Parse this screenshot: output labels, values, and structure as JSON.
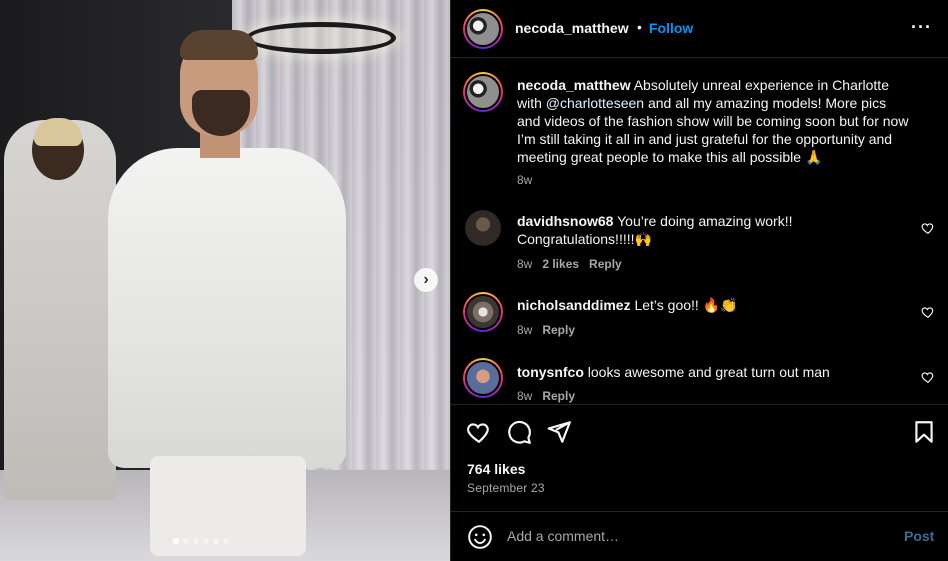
{
  "post": {
    "image_alt": "",
    "carousel_dots": 6,
    "active_dot": 0
  },
  "header": {
    "username": "necoda_matthew",
    "separator": "•",
    "follow_label": "Follow",
    "more_icon": "more-options-icon"
  },
  "caption": {
    "username": "necoda_matthew",
    "text_before": "Absolutely unreal experience in Charlotte with ",
    "mention": "@charlotteseen",
    "text_after": " and all my amazing models! More pics and videos of the fashion show will be coming soon but for now I’m still taking it all in and just grateful for the opportunity and meeting great people to make this all possible 🙏",
    "time": "8w"
  },
  "comments": [
    {
      "username": "davidhsnow68",
      "text": "You’re doing amazing work!! Congratulations!!!!!🙌",
      "time": "8w",
      "likes": "2 likes",
      "reply": "Reply"
    },
    {
      "username": "nicholsanddimez",
      "text": "Let’s goo!! 🔥👏",
      "time": "8w",
      "likes": "",
      "reply": "Reply"
    },
    {
      "username": "tonysnfco",
      "text": "looks awesome and great turn out man",
      "time": "8w",
      "likes": "",
      "reply": "Reply"
    }
  ],
  "actions": {
    "likes": "764 likes",
    "date": "September 23"
  },
  "add_comment": {
    "placeholder": "Add a comment…",
    "post_label": "Post"
  },
  "colors": {
    "background": "#000000",
    "link_blue": "#0095f6",
    "secondary_text": "#a8a8a8",
    "post_disabled": "#3f6a92"
  }
}
